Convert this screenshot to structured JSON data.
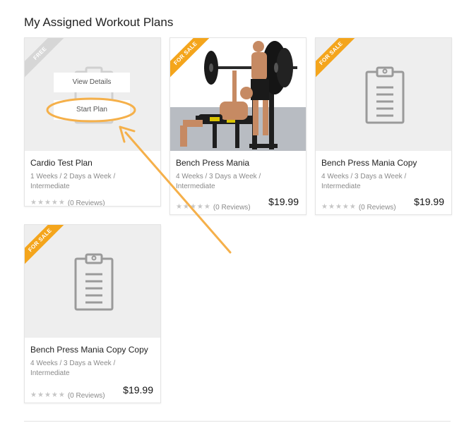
{
  "page": {
    "title": "My Assigned Workout Plans"
  },
  "cards": [
    {
      "ribbon": "FREE",
      "title": "Cardio Test Plan",
      "meta": "1 Weeks / 2 Days a Week /",
      "level": "Intermediate",
      "reviews": "(0 Reviews)",
      "price": "",
      "overlay": {
        "view": "View Details",
        "start": "Start Plan"
      }
    },
    {
      "ribbon": "FOR SALE",
      "title": "Bench Press Mania",
      "meta": "4 Weeks / 3 Days a Week /",
      "level": "Intermediate",
      "reviews": "(0 Reviews)",
      "price": "$19.99"
    },
    {
      "ribbon": "FOR SALE",
      "title": "Bench Press Mania Copy",
      "meta": "4 Weeks / 3 Days a Week /",
      "level": "Intermediate",
      "reviews": "(0 Reviews)",
      "price": "$19.99"
    },
    {
      "ribbon": "FOR SALE",
      "title": "Bench Press Mania Copy Copy",
      "meta": "4 Weeks / 3 Days a Week /",
      "level": "Intermediate",
      "reviews": "(0 Reviews)",
      "price": "$19.99"
    }
  ],
  "rating_stars": 0,
  "colors": {
    "accent_orange": "#f4a51c",
    "annotation": "#f5b04a",
    "free_ribbon": "#d6d6d6"
  },
  "icons": {
    "placeholder": "clipboard-icon",
    "star": "star-icon"
  }
}
